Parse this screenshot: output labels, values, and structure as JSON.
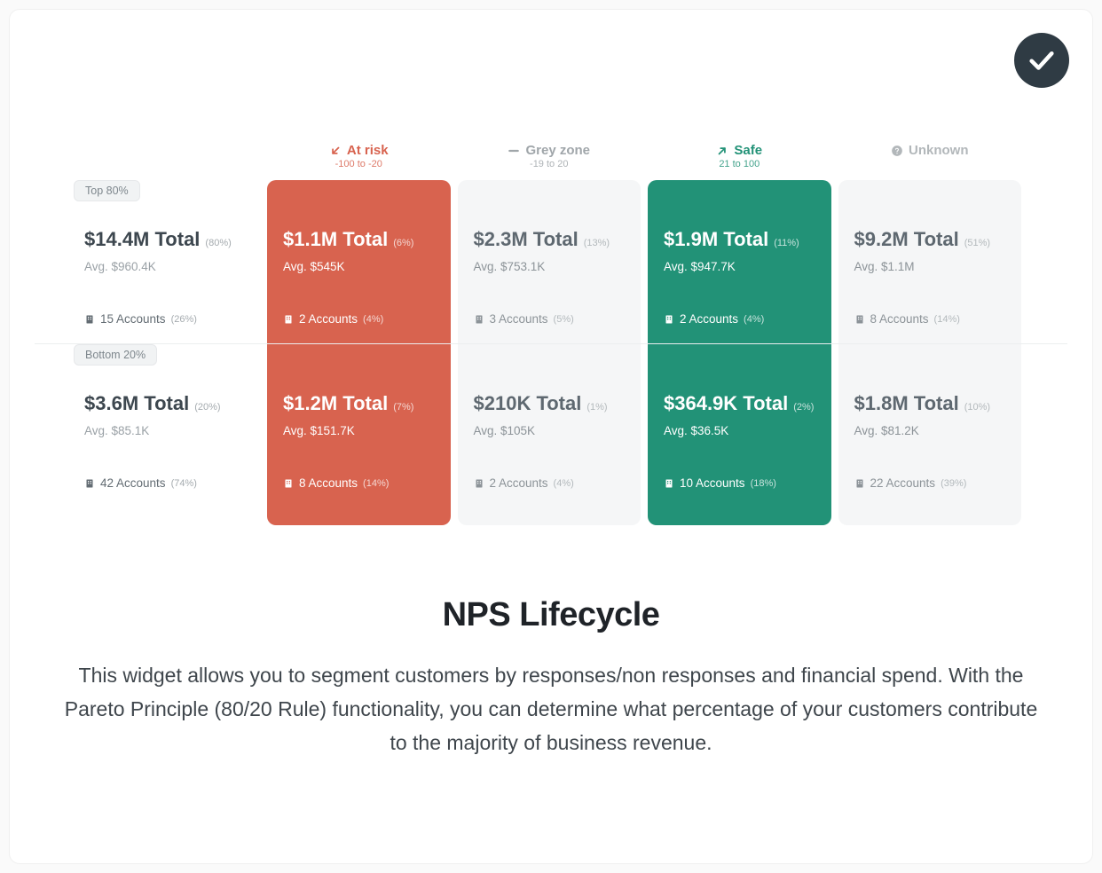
{
  "columns": [
    {
      "id": "risk",
      "label": "At risk",
      "sub": "-100 to -20"
    },
    {
      "id": "grey",
      "label": "Grey zone",
      "sub": "-19 to 20"
    },
    {
      "id": "safe",
      "label": "Safe",
      "sub": "21 to 100"
    },
    {
      "id": "unknown",
      "label": "Unknown",
      "sub": ""
    }
  ],
  "rows": [
    {
      "badge": "Top 80%",
      "summary": {
        "total": "$14.4M Total",
        "pct": "(80%)",
        "avg": "Avg. $960.4K",
        "accounts": "15 Accounts",
        "apct": "(26%)"
      },
      "cells": {
        "risk": {
          "total": "$1.1M Total",
          "pct": "(6%)",
          "avg": "Avg. $545K",
          "accounts": "2 Accounts",
          "apct": "(4%)"
        },
        "grey": {
          "total": "$2.3M Total",
          "pct": "(13%)",
          "avg": "Avg. $753.1K",
          "accounts": "3 Accounts",
          "apct": "(5%)"
        },
        "safe": {
          "total": "$1.9M Total",
          "pct": "(11%)",
          "avg": "Avg. $947.7K",
          "accounts": "2 Accounts",
          "apct": "(4%)"
        },
        "unknown": {
          "total": "$9.2M Total",
          "pct": "(51%)",
          "avg": "Avg. $1.1M",
          "accounts": "8 Accounts",
          "apct": "(14%)"
        }
      }
    },
    {
      "badge": "Bottom 20%",
      "summary": {
        "total": "$3.6M Total",
        "pct": "(20%)",
        "avg": "Avg. $85.1K",
        "accounts": "42 Accounts",
        "apct": "(74%)"
      },
      "cells": {
        "risk": {
          "total": "$1.2M Total",
          "pct": "(7%)",
          "avg": "Avg. $151.7K",
          "accounts": "8 Accounts",
          "apct": "(14%)"
        },
        "grey": {
          "total": "$210K Total",
          "pct": "(1%)",
          "avg": "Avg. $105K",
          "accounts": "2 Accounts",
          "apct": "(4%)"
        },
        "safe": {
          "total": "$364.9K Total",
          "pct": "(2%)",
          "avg": "Avg. $36.5K",
          "accounts": "10 Accounts",
          "apct": "(18%)"
        },
        "unknown": {
          "total": "$1.8M Total",
          "pct": "(10%)",
          "avg": "Avg. $81.2K",
          "accounts": "22 Accounts",
          "apct": "(39%)"
        }
      }
    }
  ],
  "title": "NPS Lifecycle",
  "description": "This widget allows you to segment customers by responses/non responses and financial spend. With the Pareto Principle (80/20 Rule) functionality, you can determine what percentage of your customers contribute to the majority of business revenue.",
  "labels": {
    "total_word": "Total"
  }
}
